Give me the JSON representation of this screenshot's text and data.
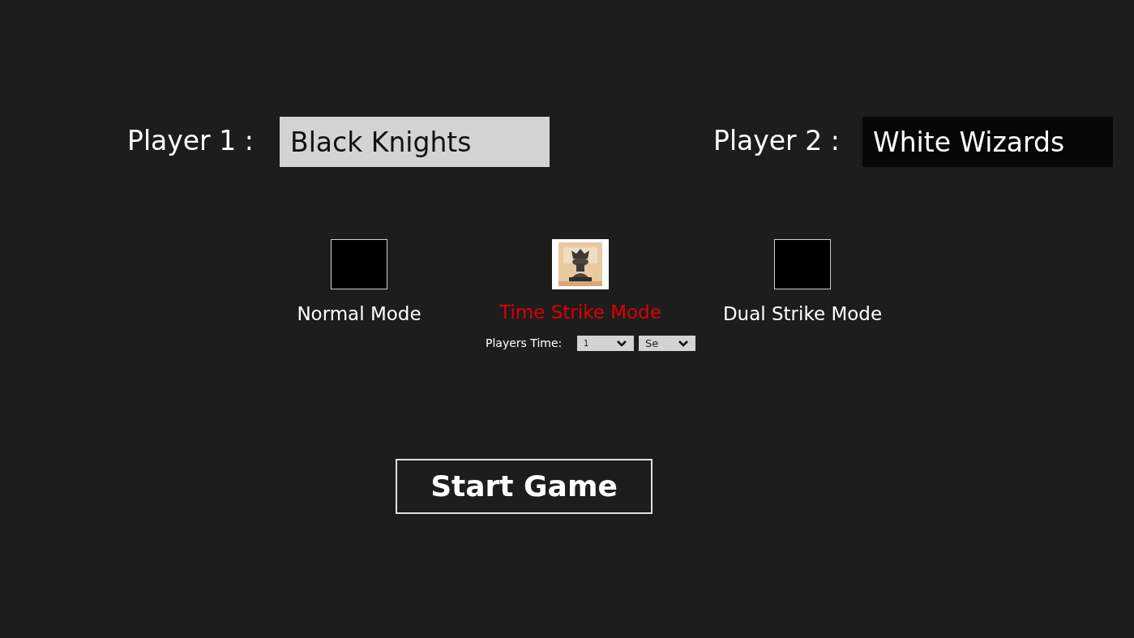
{
  "players": [
    {
      "label": "Player 1 :",
      "name": "Black Knights",
      "focused": true
    },
    {
      "label": "Player 2 :",
      "name": "White Wizards",
      "focused": false
    }
  ],
  "modes": [
    {
      "label": "Normal Mode",
      "selected": false
    },
    {
      "label": "Time Strike Mode",
      "selected": true
    },
    {
      "label": "Dual Strike Mode",
      "selected": false
    }
  ],
  "players_time": {
    "label": "Players Time:",
    "amount": "1",
    "unit": "Se"
  },
  "start_button": "Start Game"
}
